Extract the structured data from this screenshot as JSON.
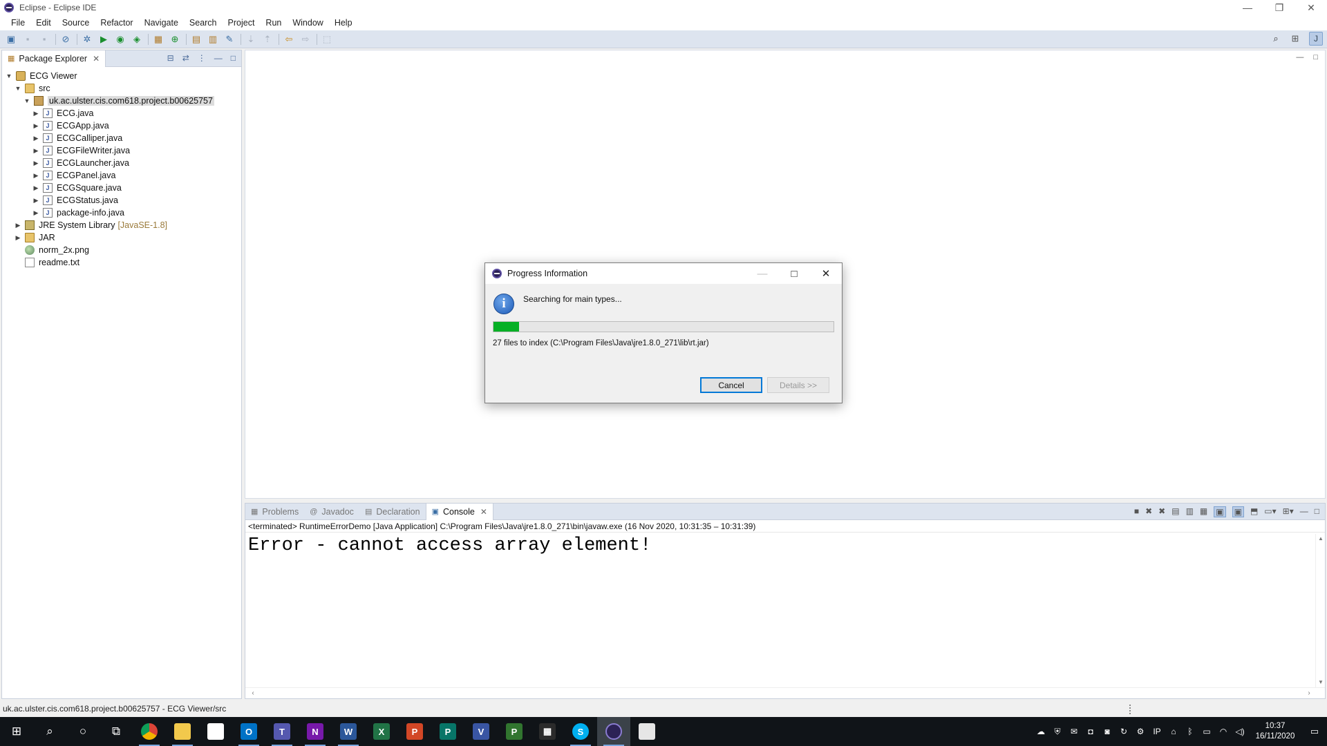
{
  "window": {
    "title": "Eclipse - Eclipse IDE",
    "controls": {
      "minimize": "—",
      "restore": "❐",
      "close": "✕"
    }
  },
  "menu": [
    "File",
    "Edit",
    "Source",
    "Refactor",
    "Navigate",
    "Search",
    "Project",
    "Run",
    "Window",
    "Help"
  ],
  "toolbar": {
    "icons": [
      "new-icon",
      "save-icon",
      "save-all-icon",
      "skip-breakpoints-icon",
      "debug-icon",
      "run-icon",
      "coverage-icon",
      "external-tools-icon",
      "new-java-project-icon",
      "new-class-icon",
      "open-type-icon",
      "open-task-icon",
      "search-icon",
      "next-annotation-icon",
      "prev-annotation-icon",
      "back-icon",
      "forward-icon",
      "pin-editor-icon"
    ],
    "right_icons": [
      "search-icon",
      "open-perspective-icon",
      "java-perspective-icon"
    ]
  },
  "package_explorer": {
    "tab_label": "Package Explorer",
    "tree": [
      {
        "label": "ECG Viewer",
        "type": "proj",
        "depth": 0,
        "expanded": true
      },
      {
        "label": "src",
        "type": "folder",
        "depth": 1,
        "expanded": true
      },
      {
        "label": "uk.ac.ulster.cis.com618.project.b00625757",
        "type": "pkg",
        "depth": 2,
        "expanded": true,
        "selected": true
      },
      {
        "label": "ECG.java",
        "type": "java",
        "depth": 3
      },
      {
        "label": "ECGApp.java",
        "type": "java",
        "depth": 3
      },
      {
        "label": "ECGCalliper.java",
        "type": "java",
        "depth": 3
      },
      {
        "label": "ECGFileWriter.java",
        "type": "java",
        "depth": 3
      },
      {
        "label": "ECGLauncher.java",
        "type": "java",
        "depth": 3
      },
      {
        "label": "ECGPanel.java",
        "type": "java",
        "depth": 3
      },
      {
        "label": "ECGSquare.java",
        "type": "java",
        "depth": 3
      },
      {
        "label": "ECGStatus.java",
        "type": "java",
        "depth": 3
      },
      {
        "label": "package-info.java",
        "type": "java",
        "depth": 3
      },
      {
        "label": "JRE System Library",
        "deco": "[JavaSE-1.8]",
        "type": "lib",
        "depth": 1,
        "expanded": false
      },
      {
        "label": "JAR",
        "type": "folder",
        "depth": 1,
        "expanded": false
      },
      {
        "label": "norm_2x.png",
        "type": "png",
        "depth": 1
      },
      {
        "label": "readme.txt",
        "type": "txt",
        "depth": 1
      }
    ]
  },
  "console": {
    "tabs": [
      {
        "label": "Problems",
        "icon": "problems-icon",
        "active": false
      },
      {
        "label": "Javadoc",
        "icon": "javadoc-icon",
        "active": false
      },
      {
        "label": "Declaration",
        "icon": "declaration-icon",
        "active": false
      },
      {
        "label": "Console",
        "icon": "console-icon",
        "active": true
      }
    ],
    "terminated_line": "<terminated> RuntimeErrorDemo [Java Application] C:\\Program Files\\Java\\jre1.8.0_271\\bin\\javaw.exe  (16 Nov 2020, 10:31:35 – 10:31:39)",
    "output": "Error - cannot access array element!"
  },
  "status_bar": {
    "text": "uk.ac.ulster.cis.com618.project.b00625757 - ECG Viewer/src"
  },
  "dialog": {
    "title": "Progress Information",
    "message": "Searching for main types...",
    "progress": 0.075,
    "detail": "27 files to index (C:\\Program Files\\Java\\jre1.8.0_271\\lib\\rt.jar)",
    "cancel_label": "Cancel",
    "details_label": "Details >>",
    "accent": "#06b025"
  },
  "taskbar": {
    "apps": [
      {
        "name": "chrome",
        "letter": "",
        "color": "#f4b400",
        "running": true
      },
      {
        "name": "file-explorer",
        "letter": "",
        "color": "#f2c94c",
        "running": true
      },
      {
        "name": "store",
        "letter": "",
        "color": "#ffffff",
        "running": false
      },
      {
        "name": "outlook",
        "letter": "O",
        "color": "#0072c6",
        "running": true
      },
      {
        "name": "teams",
        "letter": "T",
        "color": "#5558af",
        "running": true
      },
      {
        "name": "onenote",
        "letter": "N",
        "color": "#7719aa",
        "running": true
      },
      {
        "name": "word",
        "letter": "W",
        "color": "#2b579a",
        "running": true
      },
      {
        "name": "excel",
        "letter": "X",
        "color": "#217346",
        "running": false
      },
      {
        "name": "powerpoint",
        "letter": "P",
        "color": "#d24726",
        "running": false
      },
      {
        "name": "publisher",
        "letter": "P",
        "color": "#077568",
        "running": false
      },
      {
        "name": "visio",
        "letter": "V",
        "color": "#3955a3",
        "running": false
      },
      {
        "name": "project",
        "letter": "P",
        "color": "#31752f",
        "running": false
      },
      {
        "name": "calculator",
        "letter": "▦",
        "color": "#2b2b2b",
        "running": false
      },
      {
        "name": "skype",
        "letter": "S",
        "color": "#00aff0",
        "running": true
      },
      {
        "name": "eclipse",
        "letter": "",
        "color": "#2c2255",
        "running": true,
        "active": true
      },
      {
        "name": "paint",
        "letter": "",
        "color": "#e6e6e6",
        "running": false
      }
    ],
    "time": "10:37",
    "date": "16/11/2020"
  }
}
